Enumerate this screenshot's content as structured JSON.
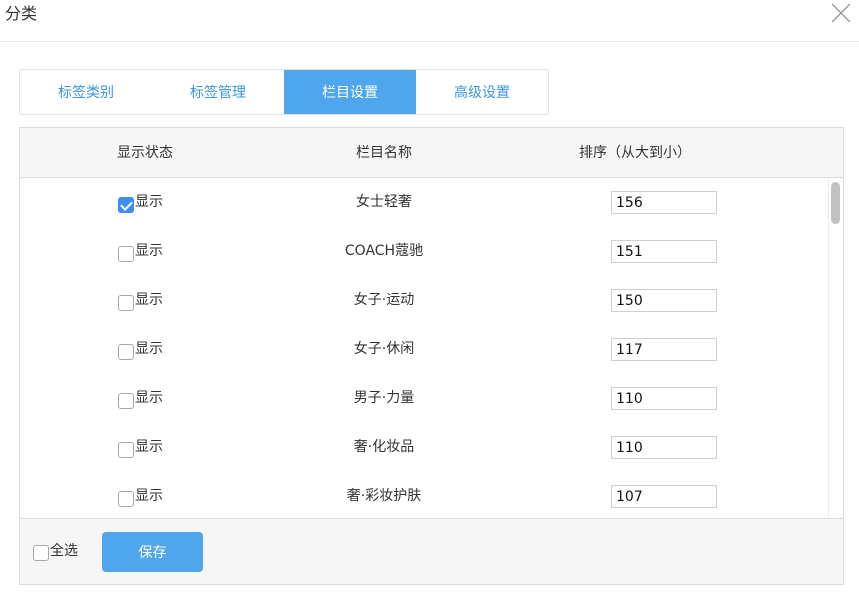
{
  "dialog": {
    "title": "分类",
    "close_icon": "close-icon"
  },
  "tabs": [
    {
      "label": "标签类别",
      "active": false
    },
    {
      "label": "标签管理",
      "active": false
    },
    {
      "label": "栏目设置",
      "active": true
    },
    {
      "label": "高级设置",
      "active": false
    }
  ],
  "table": {
    "headers": {
      "status": "显示状态",
      "name": "栏目名称",
      "sort": "排序（从大到小）"
    },
    "rows": [
      {
        "checked": true,
        "status_label": "显示",
        "name": "女士轻奢",
        "sort": "156"
      },
      {
        "checked": false,
        "status_label": "显示",
        "name": "COACH蔻驰",
        "sort": "151"
      },
      {
        "checked": false,
        "status_label": "显示",
        "name": "女子·运动",
        "sort": "150"
      },
      {
        "checked": false,
        "status_label": "显示",
        "name": "女子·休闲",
        "sort": "117"
      },
      {
        "checked": false,
        "status_label": "显示",
        "name": "男子·力量",
        "sort": "110"
      },
      {
        "checked": false,
        "status_label": "显示",
        "name": "奢·化妆品",
        "sort": "110"
      },
      {
        "checked": false,
        "status_label": "显示",
        "name": "奢·彩妆护肤",
        "sort": "107"
      }
    ]
  },
  "footer": {
    "select_all_label": "全选",
    "select_all_checked": false,
    "save_label": "保存"
  },
  "colors": {
    "accent": "#4fa6ec",
    "tab_text": "#3a97e0",
    "checkbox_checked": "#3b8ff0"
  }
}
